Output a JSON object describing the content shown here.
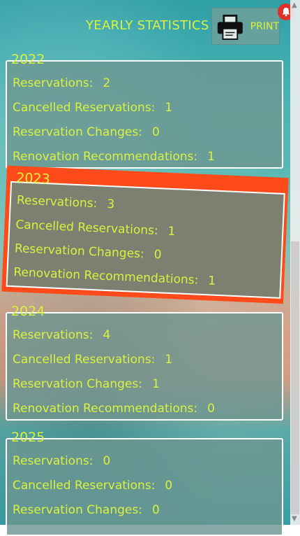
{
  "header": {
    "title": "YEARLY STATISTICS",
    "print_label": "PRINT"
  },
  "labels": {
    "reservations": "Reservations:",
    "cancelled": "Cancelled Reservations:",
    "changes": "Reservation Changes:",
    "renovation": "Renovation Recommendations:"
  },
  "years": [
    {
      "year": "2022",
      "reservations": "2",
      "cancelled": "1",
      "changes": "0",
      "renovation": "1"
    },
    {
      "year": "2023",
      "reservations": "3",
      "cancelled": "1",
      "changes": "0",
      "renovation": "1"
    },
    {
      "year": "2024",
      "reservations": "4",
      "cancelled": "1",
      "changes": "1",
      "renovation": "0"
    },
    {
      "year": "2025",
      "reservations": "0",
      "cancelled": "0",
      "changes": "0",
      "renovation": ""
    }
  ],
  "colors": {
    "accent": "#d9f23d",
    "highlight": "#ff4a1a",
    "bell": "#e0302a"
  },
  "icons": {
    "print": "printer-icon",
    "notification": "bell-icon"
  }
}
